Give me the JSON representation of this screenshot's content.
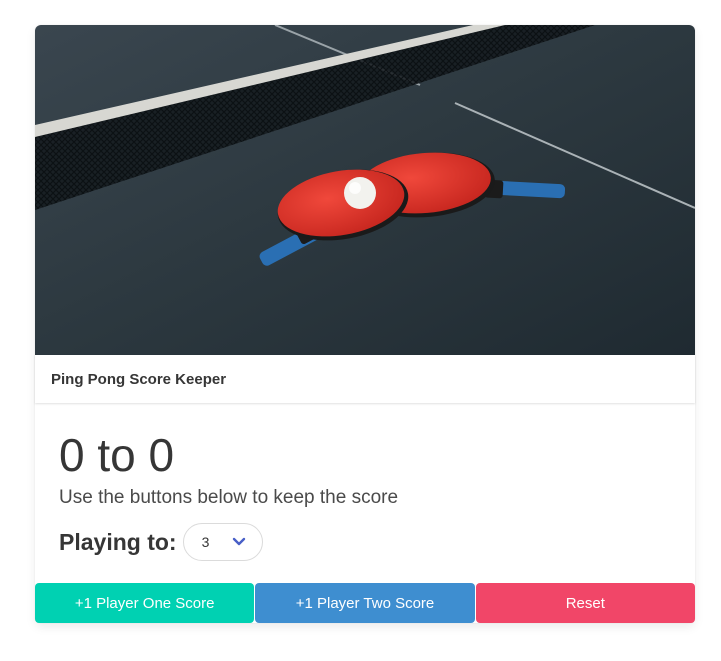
{
  "card": {
    "title": "Ping Pong Score Keeper",
    "image_description": "ping-pong-table-photo"
  },
  "score": {
    "player_one": "0",
    "separator": "to",
    "player_two": "0",
    "display": "0 to 0"
  },
  "subtitle": "Use the buttons below to keep the score",
  "playing_to": {
    "label": "Playing to:",
    "selected": "3"
  },
  "buttons": {
    "player_one": "+1 Player One Score",
    "player_two": "+1 Player Two Score",
    "reset": "Reset"
  },
  "colors": {
    "player_one": "#00d1b2",
    "player_two": "#3e8ed0",
    "reset": "#f14668",
    "chevron": "#485fc7"
  }
}
